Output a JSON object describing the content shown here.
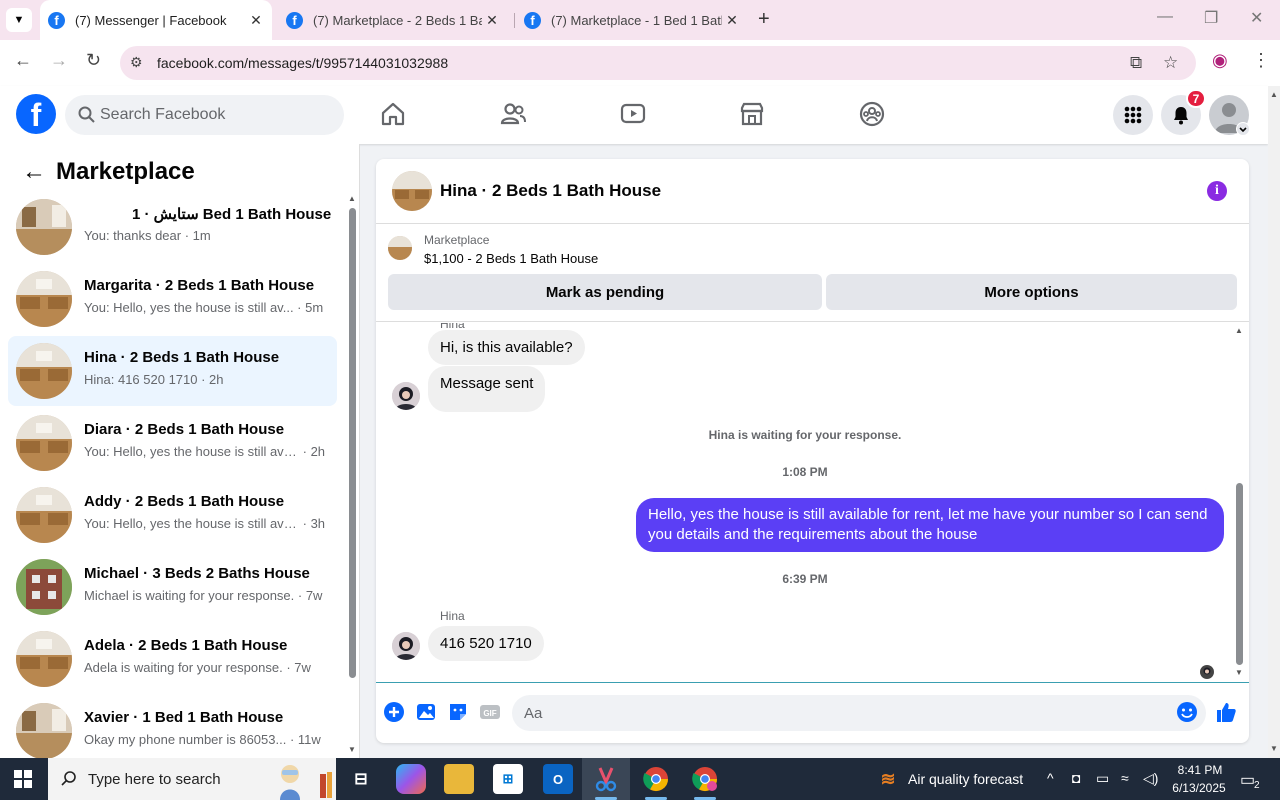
{
  "browser": {
    "tabs": [
      {
        "title": "(7) Messenger | Facebook",
        "active": true
      },
      {
        "title": "(7) Marketplace - 2 Beds 1 Bath",
        "active": false
      },
      {
        "title": "(7) Marketplace - 1 Bed 1 Bath",
        "active": false
      }
    ],
    "url": "facebook.com/messages/t/9957144031032988"
  },
  "fb_header": {
    "search_placeholder": "Search Facebook",
    "notification_count": "7"
  },
  "sidebar": {
    "title": "Marketplace",
    "conversations": [
      {
        "name": "ستايش · 1 Bed 1 Bath House",
        "preview": "You: thanks dear",
        "time": "1m",
        "active": false
      },
      {
        "name": "Margarita · 2 Beds 1 Bath House",
        "preview": "You: Hello, yes the house is still av...",
        "time": "5m",
        "active": false
      },
      {
        "name": "Hina · 2 Beds 1 Bath House",
        "preview": "Hina: 416 520 1710",
        "time": "2h",
        "active": true
      },
      {
        "name": "Diara · 2 Beds 1 Bath House",
        "preview": "You: Hello, yes the house is still avai...",
        "time": "2h",
        "active": false
      },
      {
        "name": "Addy · 2 Beds 1 Bath House",
        "preview": "You: Hello, yes the house is still avai...",
        "time": "3h",
        "active": false
      },
      {
        "name": "Michael · 3 Beds 2 Baths House",
        "preview": "Michael is waiting for your response.",
        "time": "7w",
        "active": false
      },
      {
        "name": "Adela · 2 Beds 1 Bath House",
        "preview": "Adela is waiting for your response.",
        "time": "7w",
        "active": false
      },
      {
        "name": "Xavier · 1 Bed 1 Bath House",
        "preview": "Okay my phone number is 86053...",
        "time": "11w",
        "active": false
      }
    ]
  },
  "chat": {
    "title": "Hina · 2 Beds 1 Bath House",
    "listing_source": "Marketplace",
    "listing_title": "$1,100 - 2 Beds 1 Bath House",
    "mark_pending_label": "Mark as pending",
    "more_options_label": "More options",
    "partial_sender": "Hina",
    "msg1": "Hi, is this available?",
    "msg2": "Message sent",
    "waiting_notice": "Hina is waiting for your response.",
    "time1": "1:08 PM",
    "outgoing": "Hello, yes the house is still available for rent, let me have your number so I can send you details and the requirements about the house",
    "time2": "6:39 PM",
    "sender": "Hina",
    "msg3": "416 520 1710",
    "composer_placeholder": "Aa"
  },
  "taskbar": {
    "search_placeholder": "Type here to search",
    "weather": "Air quality forecast",
    "time": "8:41 PM",
    "date": "6/13/2025",
    "notifications": "2"
  }
}
